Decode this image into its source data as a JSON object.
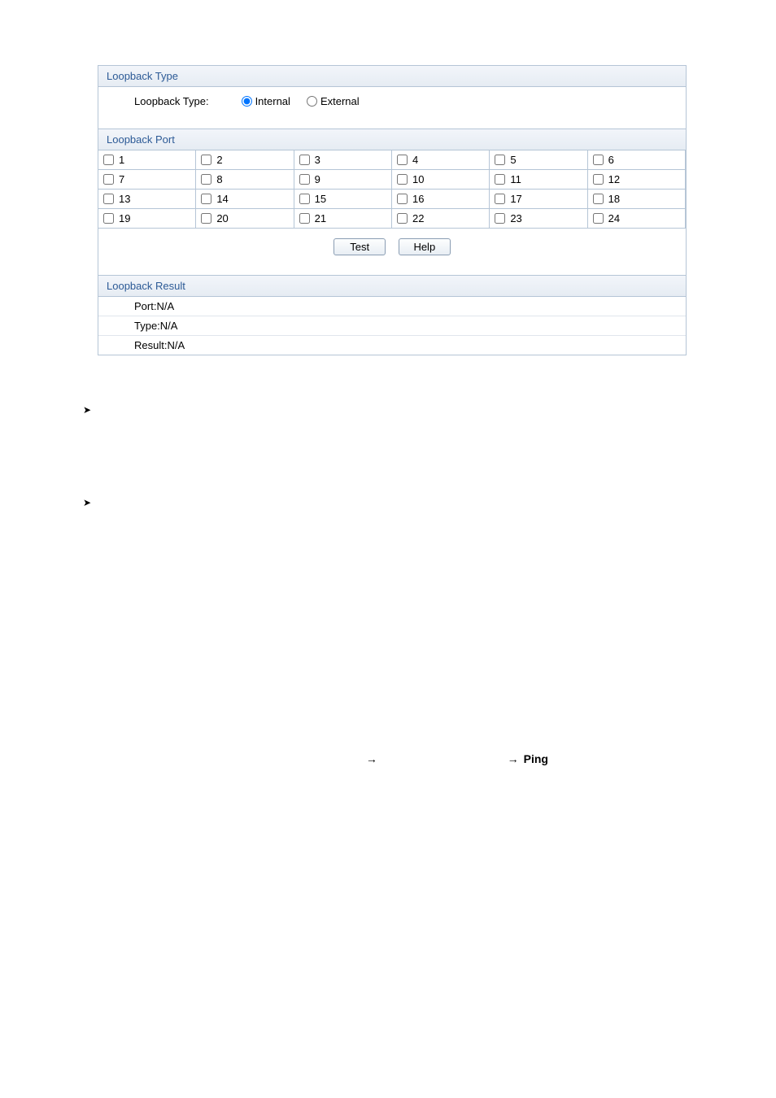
{
  "sections": {
    "type_header": "Loopback Type",
    "type_label": "Loopback Type:",
    "radios": {
      "internal": "Internal",
      "external": "External",
      "selected": "internal"
    },
    "port_header": "Loopback Port",
    "ports": [
      "1",
      "2",
      "3",
      "4",
      "5",
      "6",
      "7",
      "8",
      "9",
      "10",
      "11",
      "12",
      "13",
      "14",
      "15",
      "16",
      "17",
      "18",
      "19",
      "20",
      "21",
      "22",
      "23",
      "24"
    ],
    "buttons": {
      "test": "Test",
      "help": "Help"
    },
    "result_header": "Loopback Result",
    "results": {
      "port_label": "Port:",
      "port_val": "N/A",
      "type_label": "Type:",
      "type_val": "N/A",
      "result_label": "Result:",
      "result_val": "N/A"
    }
  },
  "bullets": {
    "glyph1": "➤",
    "glyph2": "➤"
  },
  "bottom": {
    "arrow": "→",
    "ping": "Ping"
  }
}
